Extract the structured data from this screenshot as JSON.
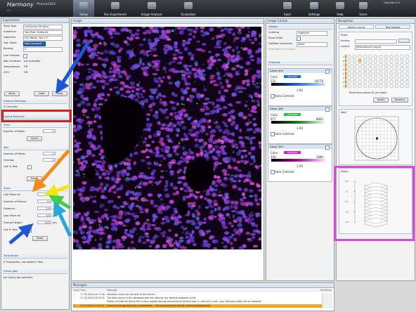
{
  "app": {
    "logo": "Harmony",
    "logo_sub": "PhenoLOGIC",
    "version": "4.9"
  },
  "toolbar": {
    "items": [
      {
        "label": "Setup"
      },
      {
        "label": "Run Experiment"
      },
      {
        "label": "Image Analysis"
      },
      {
        "label": "Evaluation"
      },
      {
        "label": "Eject"
      },
      {
        "label": "Settings"
      },
      {
        "label": "Help"
      },
      {
        "label": "Users"
      }
    ],
    "user": "Operetta CLS"
  },
  "left_panel": {
    "experiment_label": "Experiment",
    "fields": [
      {
        "key": "Plate Type",
        "value": "CellCarrier-96 Ultra"
      },
      {
        "key": "Autofocus",
        "value": "Two Peak (Default)"
      },
      {
        "key": "Objective",
        "value": "20x Water, NA 1.0"
      },
      {
        "key": "Opt. Mode",
        "value": "Non-Confocal"
      },
      {
        "key": "Binning",
        "value": "2"
      }
    ],
    "live_preview": "Live Preview:",
    "max_duration_key": "Max Duration:",
    "max_duration_val": "not available",
    "temperature_key": "Temperature:",
    "temperature_val": "Off",
    "co2_key": "CO2:",
    "co2_val": "Off",
    "buttons": [
      "Move",
      "Load",
      "Snap"
    ],
    "channel_selection": "Channel Selection",
    "channels_count": "3 Channels",
    "layout_selection": "Layout Selection",
    "plate_label": "Plate",
    "wells_label": "Number of Wells:",
    "wells_value": "1",
    "select_btn": "Select",
    "well_label": "Well",
    "fields_label": "Number of Fields:",
    "fields_value": "1",
    "overlap_label": "Overlap:",
    "overlap_value": "0",
    "overlap_unit": "%",
    "use_in_test_label": "Use in Test:",
    "reset_btn": "Reset",
    "stack_label": "Stack",
    "stack_fields": [
      {
        "key": "First Plane at:",
        "value": "-5.0"
      },
      {
        "key": "Number of Planes:",
        "value": "11"
      },
      {
        "key": "Distance:",
        "value": "1.0"
      },
      {
        "key": "Last Plane at:",
        "value": "5.0"
      },
      {
        "key": "Overall Height:",
        "value": "10.0"
      }
    ],
    "stack_unit": "µm",
    "use_in_test2": "Use in Test:",
    "reset_btn2": "Reset",
    "time_series": "Time Series",
    "time_series_val": "0 Timepoints, not saved in Test.",
    "online_jobs": "Online Jobs",
    "online_jobs_val": "No Online Job selected."
  },
  "image_panel": {
    "title": "Image"
  },
  "image_control": {
    "title": "Image Control",
    "display_label": "Display",
    "coloring_key": "Coloring",
    "coloring_val": "Highlight",
    "show_scale": "Show Scale",
    "flatfield_key": "Flatfield Correction",
    "flatfield_val": "None",
    "brightfield": "Brightfield Correction",
    "channels_label": "Channels",
    "channels": [
      {
        "name": "Alexa 405",
        "swatch": "#1e6bd6",
        "swatch_text": "Alexa405",
        "min": "231",
        "max": "18778",
        "gamma": "1.00",
        "auto": "Auto Contrast"
      },
      {
        "name": "Alexa 488",
        "swatch": "#25c33c",
        "swatch_text": "Alexa488",
        "min": "977",
        "max": "8863",
        "gamma": "1.00",
        "auto": "Auto Contrast"
      },
      {
        "name": "Alexa 594",
        "swatch": "#e018d8",
        "swatch_text": "Alexa594",
        "min": "209",
        "max": "1686",
        "gamma": "1.00",
        "auto": "Auto Contrast"
      }
    ]
  },
  "navigation": {
    "title": "Navigation",
    "tab_define": "Define Layout",
    "tab_test": "Test Images",
    "plate_label": "Plate",
    "access_key": "Access:",
    "layout_key": "Layout:",
    "layout_val": "Measurement Layout",
    "restrictions": "Restrictions above 62 µm height",
    "select_btn": "Select",
    "deselect_btn": "Deselect",
    "well_label": "Well",
    "stack_label": "Stack",
    "stack_ticks": [
      "5.0",
      "2.5",
      "0.0",
      "-2.5",
      "-5.0"
    ]
  },
  "messages": {
    "title": "Messages",
    "cols": [
      "Level",
      "Time",
      "Message",
      "Help",
      "Show"
    ],
    "rows": [
      {
        "level": "warn",
        "time": "17.10.2024 10:17:46",
        "text": "Harmony could not connect to the device."
      },
      {
        "level": "warn",
        "time": "17.10.2024 10:24:34",
        "text": "The daily dump of the database was not used by any backup software so far."
      },
      {
        "level": "info",
        "time": "",
        "text": "Please include the dump file in your regular backup procedure to ensure that, in case of a crash, your Harmony data can be restored."
      },
      {
        "level": "warn",
        "time": "17.10.2024 11:15:21",
        "text": "Acquiring image alignment parameters... The measurement will be started subsequently."
      }
    ]
  },
  "colors": {
    "highlight_red": "#d42020",
    "highlight_magenta": "#d94bd4",
    "arrow_blue": "#1f56d6",
    "arrow_orange": "#f28c1e",
    "arrow_yellow": "#f4e418",
    "arrow_green": "#3fcf4a",
    "arrow_cyan": "#2aa6d8"
  }
}
